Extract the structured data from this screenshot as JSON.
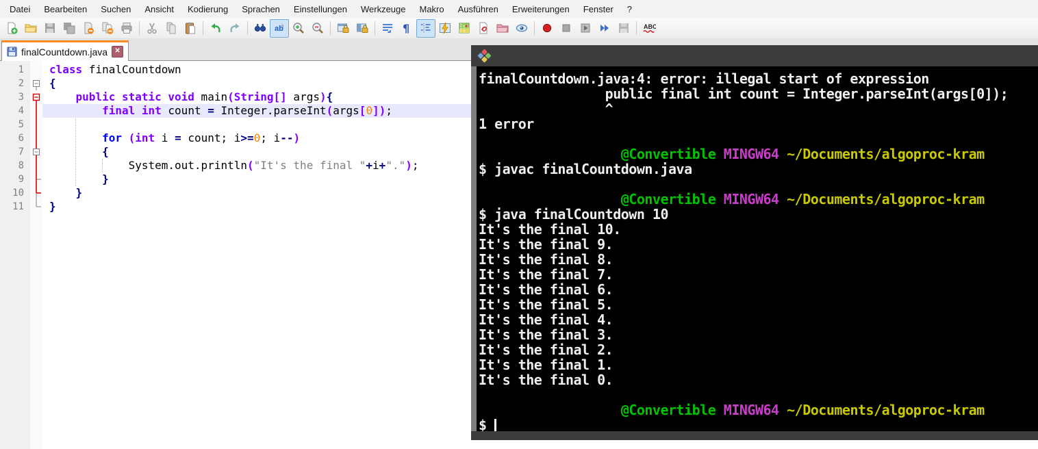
{
  "menu": {
    "items": [
      "Datei",
      "Bearbeiten",
      "Suchen",
      "Ansicht",
      "Kodierung",
      "Sprachen",
      "Einstellungen",
      "Werkzeuge",
      "Makro",
      "Ausführen",
      "Erweiterungen",
      "Fenster",
      "?"
    ]
  },
  "toolbar": {
    "buttons": [
      {
        "name": "new-file"
      },
      {
        "name": "open-file"
      },
      {
        "name": "save",
        "disabled": true
      },
      {
        "name": "save-all",
        "disabled": true
      },
      {
        "name": "close-file"
      },
      {
        "name": "close-all"
      },
      {
        "name": "print"
      },
      {
        "name": "cut",
        "disabled": true,
        "sep": true
      },
      {
        "name": "copy",
        "disabled": true
      },
      {
        "name": "paste"
      },
      {
        "name": "undo",
        "sep": true
      },
      {
        "name": "redo",
        "disabled": true
      },
      {
        "name": "find",
        "sep": true
      },
      {
        "name": "replace",
        "pressed": true
      },
      {
        "name": "zoom-in"
      },
      {
        "name": "zoom-out"
      },
      {
        "name": "sync-vertical",
        "sep": true
      },
      {
        "name": "sync-horizontal"
      },
      {
        "name": "word-wrap",
        "sep": true
      },
      {
        "name": "show-all-characters"
      },
      {
        "name": "show-indent-guide",
        "pressed": true
      },
      {
        "name": "function-completion"
      },
      {
        "name": "document-map"
      },
      {
        "name": "function-list"
      },
      {
        "name": "folder-as-workspace"
      },
      {
        "name": "document-monitor"
      },
      {
        "name": "macro-record",
        "sep": true
      },
      {
        "name": "macro-stop",
        "disabled": true
      },
      {
        "name": "macro-play",
        "disabled": true
      },
      {
        "name": "macro-run-multiple"
      },
      {
        "name": "macro-save",
        "disabled": true
      },
      {
        "name": "spell-check",
        "sep": true
      }
    ]
  },
  "tabs": [
    {
      "title": "finalCountdown.java",
      "active": true,
      "saved": true
    }
  ],
  "editor": {
    "lines": [
      {
        "no": "1",
        "fold": "",
        "hl": false,
        "segs": [
          {
            "t": "class",
            "c": "k"
          },
          {
            "t": " finalCountdown",
            "c": "p"
          }
        ]
      },
      {
        "no": "2",
        "fold": "b",
        "hl": false,
        "segs": [
          {
            "t": "{",
            "c": "c"
          }
        ]
      },
      {
        "no": "3",
        "fold": "br",
        "hl": false,
        "segs": [
          {
            "t": "    ",
            "c": "p"
          },
          {
            "t": "public static void",
            "c": "k"
          },
          {
            "t": " main",
            "c": "p"
          },
          {
            "t": "(",
            "c": "b"
          },
          {
            "t": "String",
            "c": "k"
          },
          {
            "t": "[]",
            "c": "b"
          },
          {
            "t": " args",
            "c": "p"
          },
          {
            "t": ")",
            "c": "b"
          },
          {
            "t": "{",
            "c": "c"
          }
        ]
      },
      {
        "no": "4",
        "fold": "v",
        "hl": true,
        "segs": [
          {
            "t": "        ",
            "c": "p"
          },
          {
            "t": "final",
            "c": "k"
          },
          {
            "t": " ",
            "c": "p"
          },
          {
            "t": "int",
            "c": "k"
          },
          {
            "t": " count ",
            "c": "p"
          },
          {
            "t": "=",
            "c": "o"
          },
          {
            "t": " Integer.parseInt",
            "c": "p"
          },
          {
            "t": "(",
            "c": "b"
          },
          {
            "t": "args",
            "c": "p"
          },
          {
            "t": "[",
            "c": "b"
          },
          {
            "t": "0",
            "c": "n"
          },
          {
            "t": "]",
            "c": "b"
          },
          {
            "t": ")",
            "c": "b"
          },
          {
            "t": ";",
            "c": "p"
          }
        ]
      },
      {
        "no": "5",
        "fold": "v",
        "hl": false,
        "segs": []
      },
      {
        "no": "6",
        "fold": "v",
        "hl": false,
        "segs": [
          {
            "t": "        ",
            "c": "p"
          },
          {
            "t": "for",
            "c": "f"
          },
          {
            "t": " ",
            "c": "p"
          },
          {
            "t": "(",
            "c": "b"
          },
          {
            "t": "int",
            "c": "k"
          },
          {
            "t": " i ",
            "c": "p"
          },
          {
            "t": "=",
            "c": "o"
          },
          {
            "t": " count; i",
            "c": "p"
          },
          {
            "t": ">=",
            "c": "o"
          },
          {
            "t": "0",
            "c": "n"
          },
          {
            "t": "; i",
            "c": "p"
          },
          {
            "t": "--",
            "c": "o"
          },
          {
            "t": ")",
            "c": "b"
          }
        ]
      },
      {
        "no": "7",
        "fold": "bi",
        "hl": false,
        "segs": [
          {
            "t": "        ",
            "c": "p"
          },
          {
            "t": "{",
            "c": "c"
          }
        ]
      },
      {
        "no": "8",
        "fold": "v",
        "hl": false,
        "segs": [
          {
            "t": "            System.out.println",
            "c": "p"
          },
          {
            "t": "(",
            "c": "b"
          },
          {
            "t": "\"It's the final \"",
            "c": "s"
          },
          {
            "t": "+",
            "c": "o"
          },
          {
            "t": "i",
            "c": "p"
          },
          {
            "t": "+",
            "c": "o"
          },
          {
            "t": "\".\"",
            "c": "s"
          },
          {
            "t": ")",
            "c": "b"
          },
          {
            "t": ";",
            "c": "p"
          }
        ]
      },
      {
        "no": "9",
        "fold": "vi",
        "hl": false,
        "segs": [
          {
            "t": "        ",
            "c": "p"
          },
          {
            "t": "}",
            "c": "c"
          }
        ]
      },
      {
        "no": "10",
        "fold": "er",
        "hl": false,
        "segs": [
          {
            "t": "    ",
            "c": "p"
          },
          {
            "t": "}",
            "c": "c"
          }
        ]
      },
      {
        "no": "11",
        "fold": "e",
        "hl": false,
        "segs": [
          {
            "t": "}",
            "c": "c"
          }
        ]
      }
    ]
  },
  "terminal": {
    "rows": [
      [
        {
          "t": "finalCountdown.java:4: error: illegal start of expression",
          "c": "w"
        }
      ],
      [
        {
          "t": "                public final int count = Integer.parseInt(args[0]);",
          "c": "w"
        }
      ],
      [
        {
          "t": "                ^",
          "c": "w"
        }
      ],
      [
        {
          "t": "1 error",
          "c": "w"
        }
      ],
      [],
      [
        {
          "t": "                  ",
          "c": "w"
        },
        {
          "t": "@Convertible",
          "c": "g"
        },
        {
          "t": " ",
          "c": "w"
        },
        {
          "t": "MINGW64",
          "c": "m"
        },
        {
          "t": " ",
          "c": "w"
        },
        {
          "t": "~/Documents/algoproc-kram",
          "c": "y"
        }
      ],
      [
        {
          "t": "$ javac finalCountdown.java",
          "c": "w"
        }
      ],
      [],
      [
        {
          "t": "                  ",
          "c": "w"
        },
        {
          "t": "@Convertible",
          "c": "g"
        },
        {
          "t": " ",
          "c": "w"
        },
        {
          "t": "MINGW64",
          "c": "m"
        },
        {
          "t": " ",
          "c": "w"
        },
        {
          "t": "~/Documents/algoproc-kram",
          "c": "y"
        }
      ],
      [
        {
          "t": "$ java finalCountdown 10",
          "c": "w"
        }
      ],
      [
        {
          "t": "It's the final 10.",
          "c": "w"
        }
      ],
      [
        {
          "t": "It's the final 9.",
          "c": "w"
        }
      ],
      [
        {
          "t": "It's the final 8.",
          "c": "w"
        }
      ],
      [
        {
          "t": "It's the final 7.",
          "c": "w"
        }
      ],
      [
        {
          "t": "It's the final 6.",
          "c": "w"
        }
      ],
      [
        {
          "t": "It's the final 5.",
          "c": "w"
        }
      ],
      [
        {
          "t": "It's the final 4.",
          "c": "w"
        }
      ],
      [
        {
          "t": "It's the final 3.",
          "c": "w"
        }
      ],
      [
        {
          "t": "It's the final 2.",
          "c": "w"
        }
      ],
      [
        {
          "t": "It's the final 1.",
          "c": "w"
        }
      ],
      [
        {
          "t": "It's the final 0.",
          "c": "w"
        }
      ],
      [],
      [
        {
          "t": "                  ",
          "c": "w"
        },
        {
          "t": "@Convertible",
          "c": "g"
        },
        {
          "t": " ",
          "c": "w"
        },
        {
          "t": "MINGW64",
          "c": "m"
        },
        {
          "t": " ",
          "c": "w"
        },
        {
          "t": "~/Documents/algoproc-kram",
          "c": "y"
        }
      ],
      [
        {
          "t": "$ ",
          "c": "w"
        },
        {
          "t": "",
          "c": "cur"
        }
      ]
    ]
  },
  "colors": {
    "tab_accent_orange": "#ff8a24",
    "current_line": "#e8e8ff",
    "keyword_purple": "#8000ff",
    "keyword_blue": "#0000ff",
    "operator_navy": "#000080",
    "string_gray": "#808080",
    "number_orange": "#ff8000",
    "fold_active_red": "#dd0000",
    "terminal_green": "#00c300",
    "terminal_magenta": "#c93ec9",
    "terminal_yellow": "#c9c900",
    "terminal_titlebar": "#3c3c3c"
  }
}
